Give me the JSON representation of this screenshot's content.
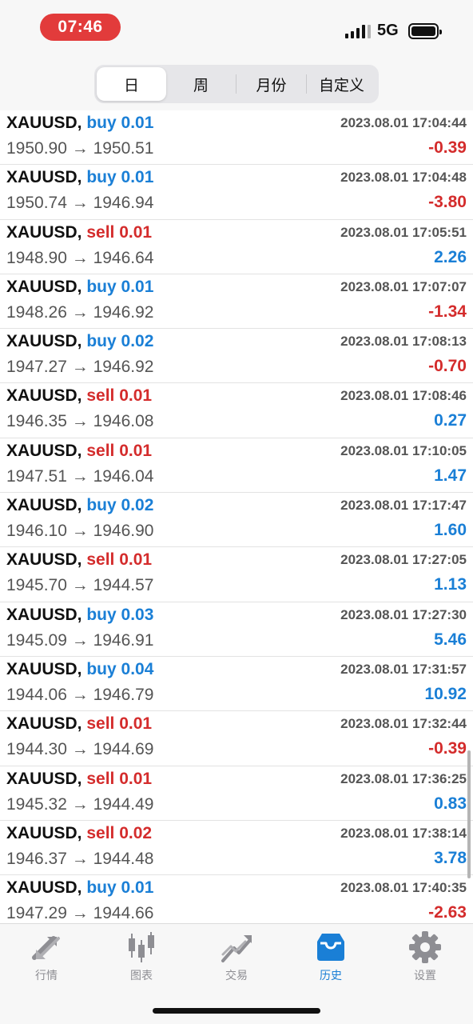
{
  "status_bar": {
    "time": "07:46",
    "network": "5G"
  },
  "period_tabs": [
    {
      "label": "日",
      "active": true
    },
    {
      "label": "周",
      "active": false
    },
    {
      "label": "月份",
      "active": false
    },
    {
      "label": "自定义",
      "active": false
    }
  ],
  "trades": [
    {
      "symbol": "XAUUSD,",
      "side": "buy",
      "volume": "0.01",
      "prices": "1950.90 → 1950.51",
      "time": "2023.08.01 17:04:44",
      "profit": "-0.39"
    },
    {
      "symbol": "XAUUSD,",
      "side": "buy",
      "volume": "0.01",
      "prices": "1950.74 → 1946.94",
      "time": "2023.08.01 17:04:48",
      "profit": "-3.80"
    },
    {
      "symbol": "XAUUSD,",
      "side": "sell",
      "volume": "0.01",
      "prices": "1948.90 → 1946.64",
      "time": "2023.08.01 17:05:51",
      "profit": "2.26"
    },
    {
      "symbol": "XAUUSD,",
      "side": "buy",
      "volume": "0.01",
      "prices": "1948.26 → 1946.92",
      "time": "2023.08.01 17:07:07",
      "profit": "-1.34"
    },
    {
      "symbol": "XAUUSD,",
      "side": "buy",
      "volume": "0.02",
      "prices": "1947.27 → 1946.92",
      "time": "2023.08.01 17:08:13",
      "profit": "-0.70"
    },
    {
      "symbol": "XAUUSD,",
      "side": "sell",
      "volume": "0.01",
      "prices": "1946.35 → 1946.08",
      "time": "2023.08.01 17:08:46",
      "profit": "0.27"
    },
    {
      "symbol": "XAUUSD,",
      "side": "sell",
      "volume": "0.01",
      "prices": "1947.51 → 1946.04",
      "time": "2023.08.01 17:10:05",
      "profit": "1.47"
    },
    {
      "symbol": "XAUUSD,",
      "side": "buy",
      "volume": "0.02",
      "prices": "1946.10 → 1946.90",
      "time": "2023.08.01 17:17:47",
      "profit": "1.60"
    },
    {
      "symbol": "XAUUSD,",
      "side": "sell",
      "volume": "0.01",
      "prices": "1945.70 → 1944.57",
      "time": "2023.08.01 17:27:05",
      "profit": "1.13"
    },
    {
      "symbol": "XAUUSD,",
      "side": "buy",
      "volume": "0.03",
      "prices": "1945.09 → 1946.91",
      "time": "2023.08.01 17:27:30",
      "profit": "5.46"
    },
    {
      "symbol": "XAUUSD,",
      "side": "buy",
      "volume": "0.04",
      "prices": "1944.06 → 1946.79",
      "time": "2023.08.01 17:31:57",
      "profit": "10.92"
    },
    {
      "symbol": "XAUUSD,",
      "side": "sell",
      "volume": "0.01",
      "prices": "1944.30 → 1944.69",
      "time": "2023.08.01 17:32:44",
      "profit": "-0.39"
    },
    {
      "symbol": "XAUUSD,",
      "side": "sell",
      "volume": "0.01",
      "prices": "1945.32 → 1944.49",
      "time": "2023.08.01 17:36:25",
      "profit": "0.83"
    },
    {
      "symbol": "XAUUSD,",
      "side": "sell",
      "volume": "0.02",
      "prices": "1946.37 → 1944.48",
      "time": "2023.08.01 17:38:14",
      "profit": "3.78"
    },
    {
      "symbol": "XAUUSD,",
      "side": "buy",
      "volume": "0.01",
      "prices": "1947.29 → 1944.66",
      "time": "2023.08.01 17:40:35",
      "profit": "-2.63"
    }
  ],
  "tabbar": [
    {
      "label": "行情",
      "icon": "quotes-arrows-icon",
      "active": false
    },
    {
      "label": "图表",
      "icon": "candlestick-chart-icon",
      "active": false
    },
    {
      "label": "交易",
      "icon": "trade-trend-icon",
      "active": false
    },
    {
      "label": "历史",
      "icon": "history-inbox-icon",
      "active": true
    },
    {
      "label": "设置",
      "icon": "gear-icon",
      "active": false
    }
  ],
  "colors": {
    "buy": "#1a7fd6",
    "sell": "#d42c2c",
    "status_time_pill": "#e23b3b",
    "tab_active": "#1a7fd6",
    "tab_inactive": "#8e8e93"
  }
}
